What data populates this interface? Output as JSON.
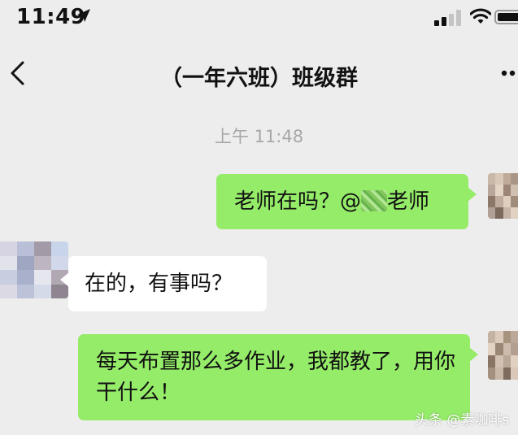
{
  "status_bar": {
    "time": "11:49",
    "icons": [
      "location-arrow-icon",
      "signal-icon",
      "wifi-icon",
      "battery-icon"
    ]
  },
  "nav": {
    "title": "（一年六班）班级群",
    "back_icon": "chevron-left-icon",
    "more_icon": "more-dots-icon"
  },
  "chat": {
    "timestamp": "上午 11:48",
    "messages": [
      {
        "side": "right",
        "text_before": "老师在吗？@",
        "text_after": "老师",
        "color": "#95ec69"
      },
      {
        "side": "left",
        "text": "在的，有事吗？",
        "color": "#ffffff"
      },
      {
        "side": "right",
        "text": "每天布置那么多作业，我都教了，用你干什么！",
        "color": "#95ec69"
      }
    ]
  },
  "watermark": "头条 @素咖啡s",
  "colors": {
    "background": "#ededed",
    "bubble_green": "#95ec69",
    "bubble_white": "#ffffff",
    "timestamp": "#a7a7a7"
  }
}
